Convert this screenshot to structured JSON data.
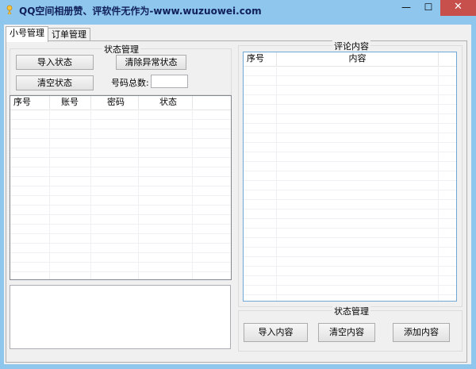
{
  "window": {
    "title": "QQ空间相册赞、评软件无作为-www.wuzuowei.com",
    "min_symbol": "—",
    "max_symbol": "☐",
    "close_symbol": "✕"
  },
  "tabs": [
    {
      "label": "小号管理",
      "active": true
    },
    {
      "label": "订单管理",
      "active": false
    }
  ],
  "left": {
    "status_group": {
      "title": "状态管理",
      "import_label": "导入状态",
      "clear_abnormal_label": "清除异常状态",
      "clear_label": "清空状态",
      "count_label": "号码总数:",
      "count_value": ""
    },
    "accounts_table": {
      "columns": [
        "序号",
        "账号",
        "密码",
        "状态"
      ],
      "rows": []
    },
    "log_text": ""
  },
  "right": {
    "comments_group": {
      "title": "评论内容",
      "columns": [
        "序号",
        "内容"
      ],
      "rows": []
    },
    "status_group": {
      "title": "状态管理",
      "import_label": "导入内容",
      "clear_label": "清空内容",
      "add_label": "添加内容"
    }
  },
  "colors": {
    "frame": "#8fc6ee",
    "close_button": "#c7504c",
    "title_text": "#10205a"
  },
  "icons": [
    "app-icon",
    "minimize-icon",
    "maximize-icon",
    "close-icon"
  ]
}
